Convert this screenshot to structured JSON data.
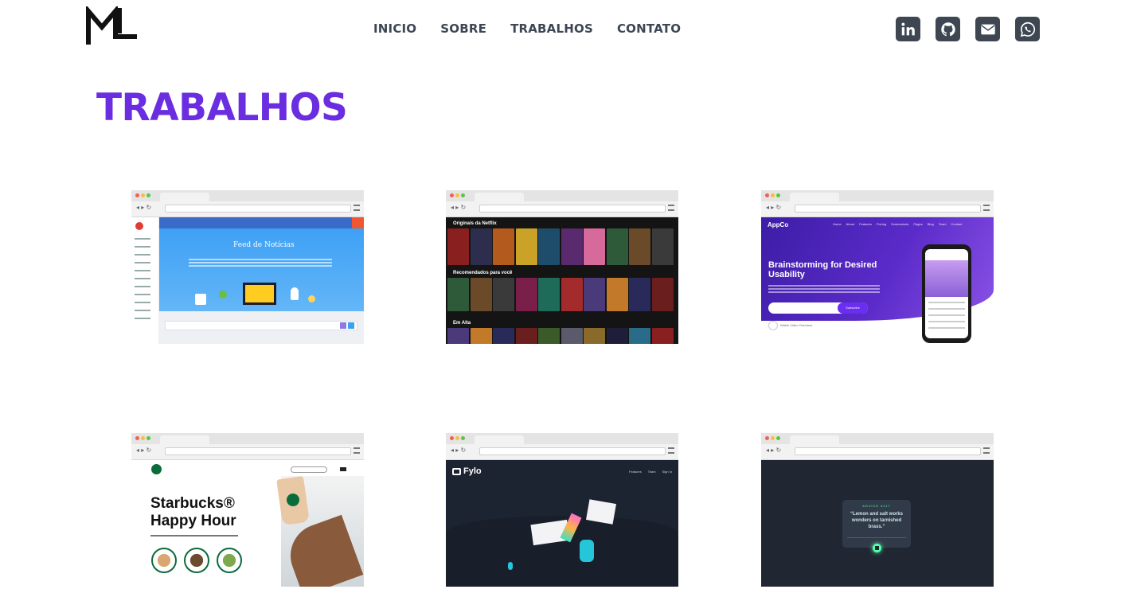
{
  "brand": {
    "logo_text": "ML"
  },
  "nav": {
    "links": [
      "INICIO",
      "SOBRE",
      "TRABALHOS",
      "CONTATO"
    ]
  },
  "social": {
    "icons": [
      "linkedin-icon",
      "github-icon",
      "envelope-icon",
      "whatsapp-icon"
    ]
  },
  "section": {
    "title": "TRABALHOS"
  },
  "colors": {
    "accent": "#6a2ee0",
    "nav_text": "#3d4654",
    "social_bg": "#3e4651"
  },
  "projects": [
    {
      "id": "facebook-clone",
      "heading": "Feed de Notícias"
    },
    {
      "id": "netflix-clone",
      "rows": [
        "Originais da Netflix",
        "Recomendados para você",
        "Em Alta"
      ]
    },
    {
      "id": "appco-landing",
      "brand": "AppCo",
      "menu": [
        "Home",
        "About",
        "Features",
        "Pricing",
        "Screenshots",
        "Pages",
        "Blog",
        "Team",
        "Contact"
      ],
      "headline": "Brainstorming for Desired Usability",
      "button": "Subscribe",
      "video_label": "Watch Video Overview"
    },
    {
      "id": "starbucks-landing",
      "headline_line1": "Starbucks®",
      "headline_line2": "Happy Hour"
    },
    {
      "id": "fylo-landing",
      "brand": "Fylo",
      "menu": [
        "Features",
        "Team",
        "Sign In"
      ]
    },
    {
      "id": "advice-generator",
      "label": "ADVICE #117",
      "quote": "“Lemon and salt works wonders on tarnished brass.”"
    }
  ]
}
